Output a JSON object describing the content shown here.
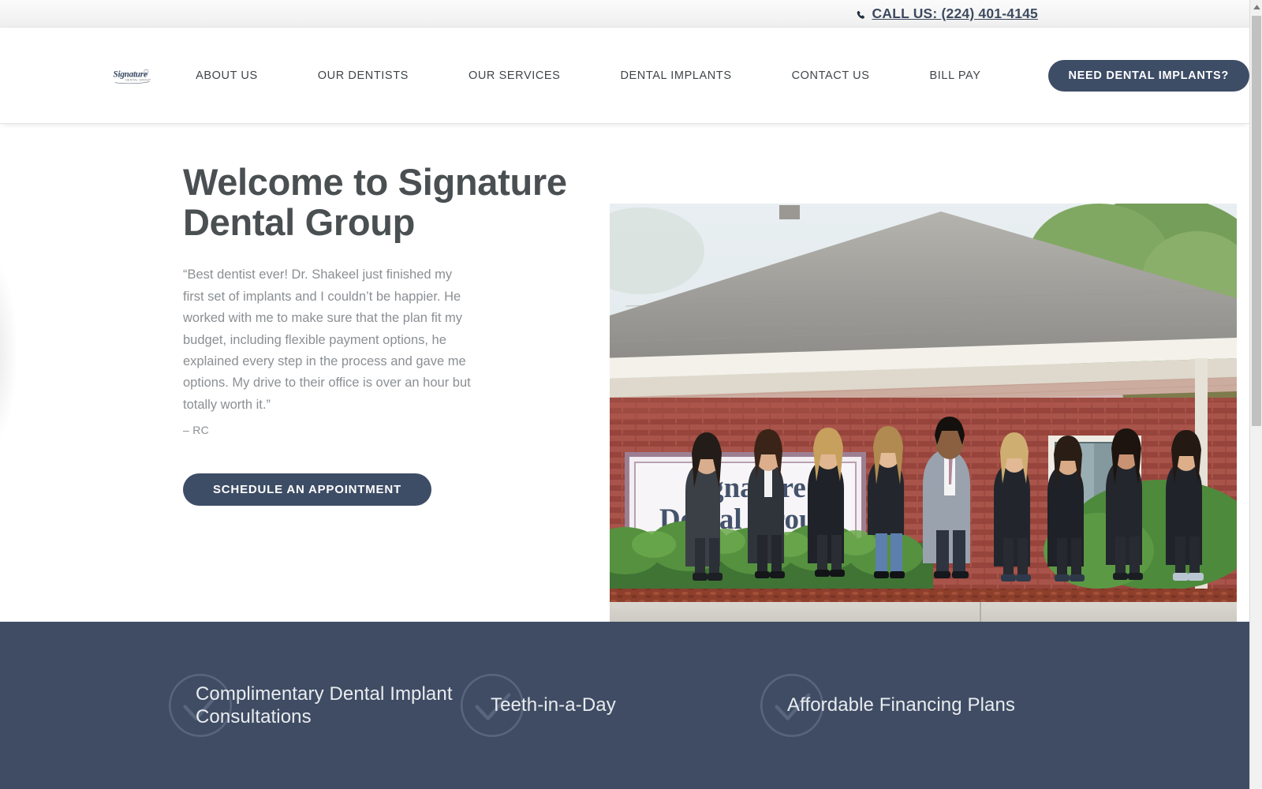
{
  "topbar": {
    "phone_icon": "phone-icon",
    "phone_label": "CALL US: (224) 401-4145"
  },
  "header": {
    "logo": {
      "wordmark": "Signature",
      "subtitle": "DENTAL GROUP",
      "icon": "tooth-icon"
    },
    "nav": [
      {
        "label": "ABOUT US"
      },
      {
        "label": "OUR DENTISTS"
      },
      {
        "label": "OUR SERVICES"
      },
      {
        "label": "DENTAL IMPLANTS"
      },
      {
        "label": "CONTACT US"
      },
      {
        "label": "BILL PAY"
      }
    ],
    "cta_label": "NEED DENTAL IMPLANTS?"
  },
  "hero": {
    "title": "Welcome to Signature Dental Group",
    "quote": "“Best dentist ever!  Dr. Shakeel just finished my first set of implants and I couldn’t be happier. He worked with me to make sure that the plan fit my budget, including flexible payment options, he explained every step in the process and gave me options. My drive to their office is over an hour but totally worth it.”",
    "attribution": "– RC",
    "button_label": "SCHEDULE AN APPOINTMENT",
    "photo_alt": "Signature Dental Group office exterior with dental team standing in front of brick building sign",
    "photo_sign_line1": "Signature",
    "photo_sign_line2": "Dental Group"
  },
  "features": [
    {
      "icon": "circle-check-icon",
      "label": "Complimentary Dental Implant Consultations"
    },
    {
      "icon": "circle-check-icon",
      "label": "Teeth-in-a-Day"
    },
    {
      "icon": "circle-check-icon",
      "label": "Affordable Financing Plans"
    }
  ],
  "colors": {
    "brand_slate": "#3f4c64",
    "button": "#3e4d66",
    "heading": "#4a4f52",
    "body_text": "#8b8f93",
    "topbar_bg": "#f3f3f3"
  },
  "scrollbar": {
    "up_arrow_icon": "caret-up-icon"
  }
}
